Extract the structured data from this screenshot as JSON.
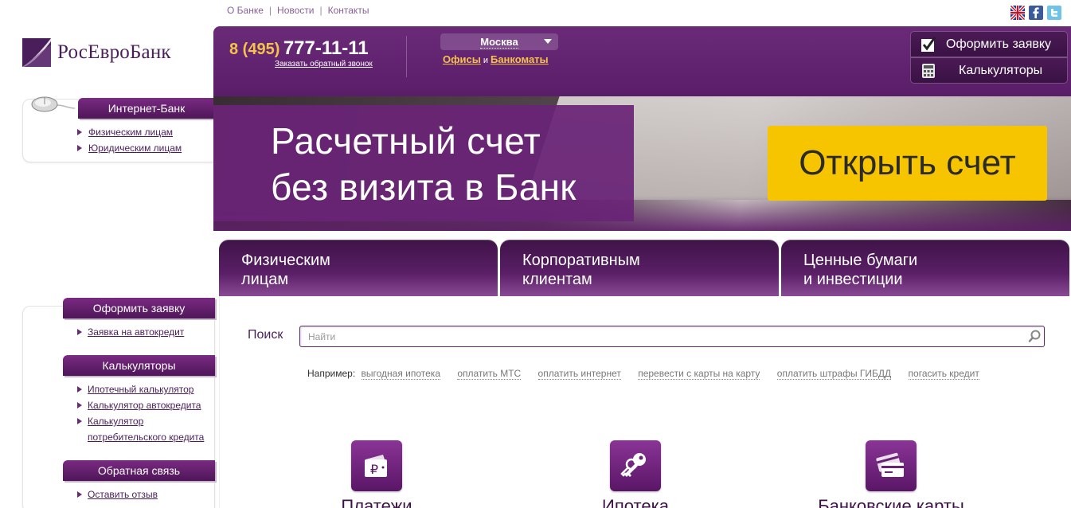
{
  "top_nav": {
    "items": [
      "О Банке",
      "Новости",
      "Контакты"
    ],
    "separator": "|"
  },
  "top_icons": [
    "uk-flag-icon",
    "facebook-icon",
    "twitter-icon"
  ],
  "logo": {
    "text": "РосЕвроБанк"
  },
  "header": {
    "phone_code": "8 (495)",
    "phone_number": "777-11-11",
    "callback_label": "Заказать обратный звонок",
    "city": "Москва",
    "offices_label": "Офисы",
    "and_label": "и",
    "atms_label": "Банкоматы",
    "apply_button": "Оформить заявку",
    "calculators_button": "Калькуляторы"
  },
  "left_panels": {
    "internet_bank": {
      "title": "Интернет-Банк",
      "links": [
        "Физическим лицам",
        "Юридическим лицам"
      ]
    },
    "apply": {
      "title": "Оформить заявку",
      "links": [
        "Заявка на автокредит"
      ]
    },
    "calculators": {
      "title": "Калькуляторы",
      "links": [
        "Ипотечный калькулятор",
        "Калькулятор автокредита",
        "Калькулятор",
        "потребительского кредита"
      ]
    },
    "feedback": {
      "title": "Обратная связь",
      "links": [
        "Оставить отзыв"
      ]
    }
  },
  "banner": {
    "line1": "Расчетный счет",
    "line2": "без визита в Банк",
    "button": "Открыть счет"
  },
  "tabs": [
    {
      "line1": "Физическим",
      "line2": "лицам"
    },
    {
      "line1": "Корпоративным",
      "line2": "клиентам"
    },
    {
      "line1": "Ценные бумаги",
      "line2": "и инвестиции"
    }
  ],
  "search": {
    "label": "Поиск",
    "placeholder": "Найти",
    "examples_label": "Например:",
    "examples": [
      "выгодная ипотека",
      "оплатить МТС",
      "оплатить интернет",
      "перевести с карты на карту",
      "оплатить штрафы ГИБДД",
      "погасить кредит"
    ]
  },
  "products": [
    {
      "label": "Платежи",
      "icon": "wallet-ruble-icon"
    },
    {
      "label": "Ипотека",
      "icon": "keys-icon"
    },
    {
      "label": "Банковские карты",
      "icon": "bank-cards-icon"
    }
  ],
  "colors": {
    "brand_purple": "#5a1d68",
    "accent_yellow": "#f7c500",
    "gold_text": "#f5c24a"
  }
}
